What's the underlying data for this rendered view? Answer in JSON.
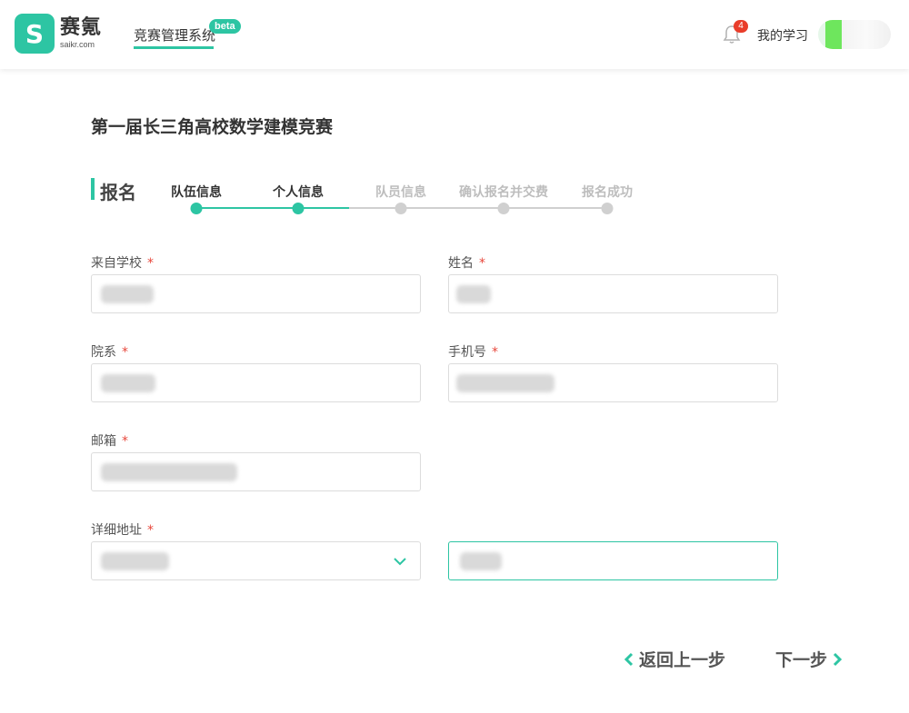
{
  "header": {
    "logo_mark": "S",
    "logo_name": "赛氪",
    "logo_domain": "saikr.com",
    "nav_label": "竞赛管理系统",
    "beta_badge": "beta",
    "notification_count": "4",
    "my_learning": "我的学习"
  },
  "competition": {
    "title": "第一届长三角高校数学建模竞赛"
  },
  "registration": {
    "section_title": "报名",
    "steps": [
      {
        "label": "队伍信息",
        "state": "done"
      },
      {
        "label": "个人信息",
        "state": "current"
      },
      {
        "label": "队员信息",
        "state": "pending"
      },
      {
        "label": "确认报名并交费",
        "state": "pending"
      },
      {
        "label": "报名成功",
        "state": "pending"
      }
    ]
  },
  "form": {
    "school": {
      "label": "来自学校",
      "required_mark": "*"
    },
    "name": {
      "label": "姓名",
      "required_mark": "*"
    },
    "department": {
      "label": "院系",
      "required_mark": "*"
    },
    "phone": {
      "label": "手机号",
      "required_mark": "*"
    },
    "email": {
      "label": "邮箱",
      "required_mark": "*"
    },
    "address": {
      "label": "详细地址",
      "required_mark": "*"
    }
  },
  "actions": {
    "prev_label": "返回上一步",
    "next_label": "下一步"
  },
  "colors": {
    "accent": "#2dc5a3",
    "required": "#e8473b",
    "badge": "#e93d2a",
    "inactive_step": "#d0d0d0"
  }
}
